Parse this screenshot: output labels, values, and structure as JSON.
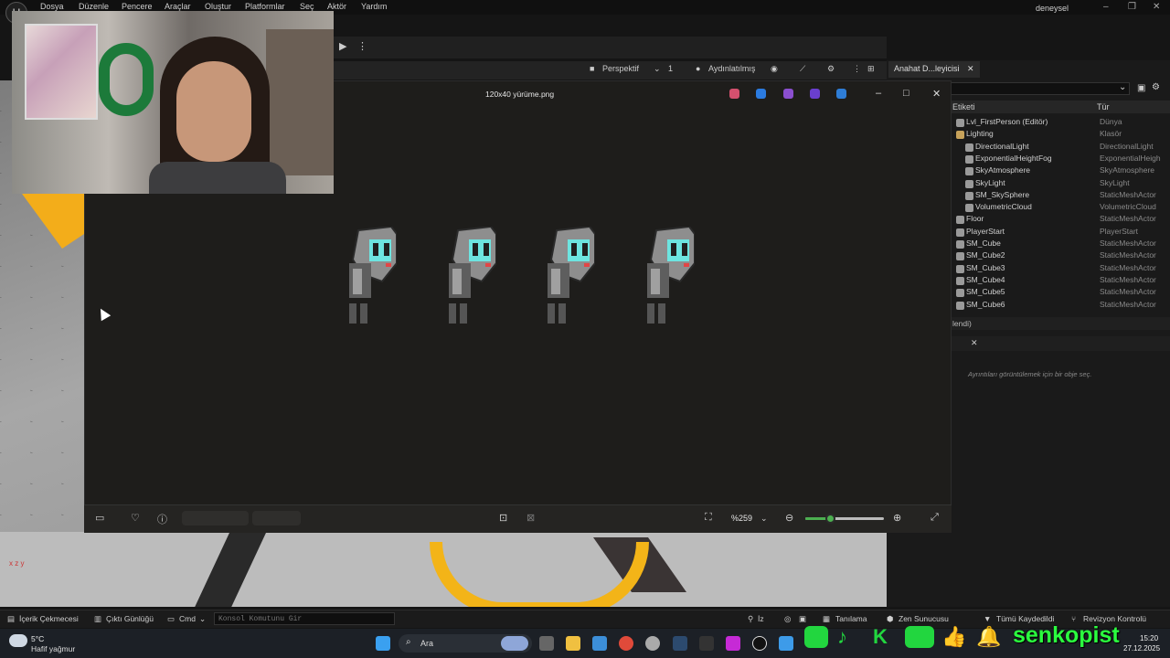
{
  "menubar": {
    "logo": "U",
    "items": [
      "Dosya",
      "Düzenle",
      "Pencere",
      "Araçlar",
      "Oluştur",
      "Platformlar",
      "Seç",
      "Aktör",
      "Yardım"
    ],
    "project_name": "deneysel",
    "window_controls": [
      "–",
      "❐",
      "✕"
    ]
  },
  "viewport": {
    "perspective_label": "Perspektif",
    "camera_speed": "1",
    "lighting_label": "Aydınlatılmış",
    "axis_label": "x  z  y"
  },
  "outliner": {
    "tab_label": "Anahat D...leyicisi",
    "col_label": "Etiketi",
    "col_type": "Tür",
    "rows": [
      {
        "name": "Lvl_FirstPerson (Editör)",
        "type": "Dünya",
        "indent": 0
      },
      {
        "name": "Lighting",
        "type": "Klasör",
        "indent": 0
      },
      {
        "name": "DirectionalLight",
        "type": "DirectionalLight",
        "indent": 1
      },
      {
        "name": "ExponentialHeightFog",
        "type": "ExponentialHeigh",
        "indent": 1
      },
      {
        "name": "SkyAtmosphere",
        "type": "SkyAtmosphere",
        "indent": 1
      },
      {
        "name": "SkyLight",
        "type": "SkyLight",
        "indent": 1
      },
      {
        "name": "SM_SkySphere",
        "type": "StaticMeshActor",
        "indent": 1
      },
      {
        "name": "VolumetricCloud",
        "type": "VolumetricCloud",
        "indent": 1
      },
      {
        "name": "Floor",
        "type": "StaticMeshActor",
        "indent": 0
      },
      {
        "name": "PlayerStart",
        "type": "PlayerStart",
        "indent": 0
      },
      {
        "name": "SM_Cube",
        "type": "StaticMeshActor",
        "indent": 0
      },
      {
        "name": "SM_Cube2",
        "type": "StaticMeshActor",
        "indent": 0
      },
      {
        "name": "SM_Cube3",
        "type": "StaticMeshActor",
        "indent": 0
      },
      {
        "name": "SM_Cube4",
        "type": "StaticMeshActor",
        "indent": 0
      },
      {
        "name": "SM_Cube5",
        "type": "StaticMeshActor",
        "indent": 0
      },
      {
        "name": "SM_Cube6",
        "type": "StaticMeshActor",
        "indent": 0
      }
    ],
    "selection_status": "lendi)",
    "details_hint": "Ayrıntıları görüntülemek için bir obje seç."
  },
  "photos": {
    "title": "120x40 yürüme.png",
    "zoom": "%259",
    "zoom_level": 0.33,
    "sprite_count": 4
  },
  "statusbar": {
    "content_drawer": "İçerik Çekmecesi",
    "output_log": "Çıktı Günlüğü",
    "cmd": "Cmd",
    "cmd_placeholder": "Konsol Komutunu Gir",
    "iz": "İz",
    "derive": "Tanılama",
    "zen": "Zen Sunucusu",
    "save_all": "Tümü Kaydedildi",
    "revision": "Revizyon Kontrolü"
  },
  "taskbar": {
    "temp": "5°C",
    "weather": "Hafif yağmur",
    "search": "Ara",
    "time": "15:20",
    "date": "27.12.2025"
  },
  "overlay": {
    "brand": "senkopist"
  },
  "colors": {
    "accent_green": "#22d63f",
    "unreal_yellow": "#f3ad1a",
    "photos_bg": "#1e1d1b"
  }
}
